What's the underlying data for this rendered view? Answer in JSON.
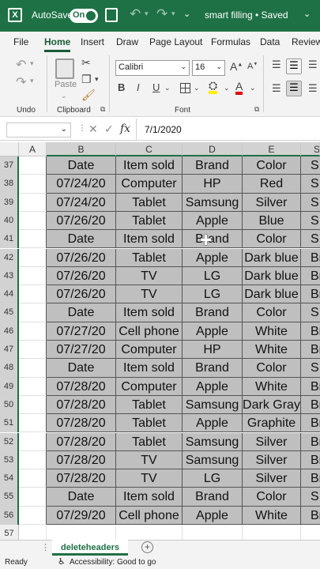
{
  "titlebar": {
    "autosave_label": "AutoSave",
    "toggle_label": "On",
    "file_title": "smart filling • Saved"
  },
  "tabs": [
    "File",
    "Home",
    "Insert",
    "Draw",
    "Page Layout",
    "Formulas",
    "Data",
    "Review"
  ],
  "active_tab": "Home",
  "ribbon": {
    "undo_group": "Undo",
    "paste_label": "Paste",
    "clipboard_group": "Clipboard",
    "font_name": "Calibri",
    "font_size": "16",
    "font_group": "Font"
  },
  "formula_bar": {
    "name_box": "",
    "fx": "fx",
    "value": "7/1/2020"
  },
  "columns": [
    "A",
    "B",
    "C",
    "D",
    "E",
    "S"
  ],
  "rows": [
    {
      "n": "37",
      "c": [
        "Date",
        "Item sold",
        "Brand",
        "Color",
        "S"
      ]
    },
    {
      "n": "38",
      "c": [
        "07/24/20",
        "Computer",
        "HP",
        "Red",
        "S"
      ]
    },
    {
      "n": "39",
      "c": [
        "07/24/20",
        "Tablet",
        "Samsung",
        "Silver",
        "S"
      ]
    },
    {
      "n": "40",
      "c": [
        "07/26/20",
        "Tablet",
        "Apple",
        "Blue",
        "S"
      ]
    },
    {
      "n": "41",
      "c": [
        "Date",
        "Item sold",
        "Brand",
        "Color",
        "S"
      ]
    },
    {
      "n": "42",
      "c": [
        "07/26/20",
        "Tablet",
        "Apple",
        "Dark blue",
        "Br"
      ]
    },
    {
      "n": "43",
      "c": [
        "07/26/20",
        "TV",
        "LG",
        "Dark blue",
        "Br"
      ]
    },
    {
      "n": "44",
      "c": [
        "07/26/20",
        "TV",
        "LG",
        "Dark blue",
        "Br"
      ]
    },
    {
      "n": "45",
      "c": [
        "Date",
        "Item sold",
        "Brand",
        "Color",
        "S"
      ]
    },
    {
      "n": "46",
      "c": [
        "07/27/20",
        "Cell phone",
        "Apple",
        "White",
        "Br"
      ]
    },
    {
      "n": "47",
      "c": [
        "07/27/20",
        "Computer",
        "HP",
        "White",
        "Br"
      ]
    },
    {
      "n": "48",
      "c": [
        "Date",
        "Item sold",
        "Brand",
        "Color",
        "S"
      ]
    },
    {
      "n": "49",
      "c": [
        "07/28/20",
        "Computer",
        "Apple",
        "White",
        "Br"
      ]
    },
    {
      "n": "50",
      "c": [
        "07/28/20",
        "Tablet",
        "Samsung",
        "Dark Gray",
        "Br"
      ]
    },
    {
      "n": "51",
      "c": [
        "07/28/20",
        "Tablet",
        "Apple",
        "Graphite",
        "Br"
      ]
    },
    {
      "n": "52",
      "c": [
        "07/28/20",
        "Tablet",
        "Samsung",
        "Silver",
        "Br"
      ]
    },
    {
      "n": "53",
      "c": [
        "07/28/20",
        "TV",
        "Samsung",
        "Silver",
        "Br"
      ]
    },
    {
      "n": "54",
      "c": [
        "07/28/20",
        "TV",
        "LG",
        "Silver",
        "Br"
      ]
    },
    {
      "n": "55",
      "c": [
        "Date",
        "Item sold",
        "Brand",
        "Color",
        "S"
      ]
    },
    {
      "n": "56",
      "c": [
        "07/29/20",
        "Cell phone",
        "Apple",
        "White",
        "Br"
      ]
    },
    {
      "n": "57",
      "c": [
        "",
        "",
        "",
        "",
        ""
      ]
    }
  ],
  "sheet_tab": "deleteheaders",
  "status": {
    "ready": "Ready",
    "accessibility": "Accessibility: Good to go"
  },
  "colors": {
    "excel_green": "#1e7145",
    "cell_fill": "#bfbfbf",
    "header_bg": "#efefef"
  }
}
